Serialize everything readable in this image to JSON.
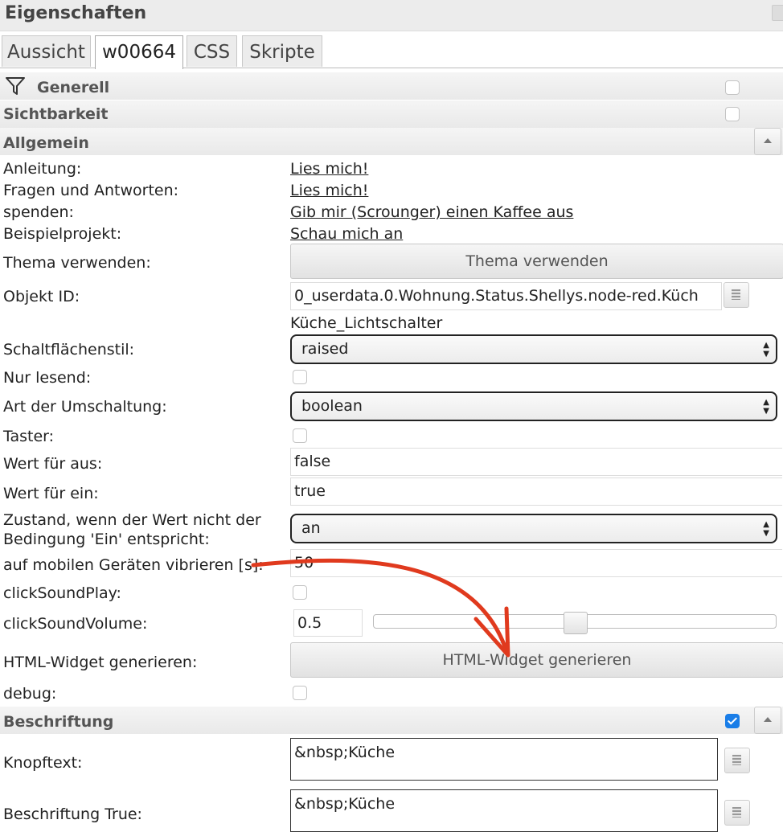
{
  "panel": {
    "title": "Eigenschaften"
  },
  "tabs": [
    {
      "label": "Aussicht"
    },
    {
      "label": "w00664"
    },
    {
      "label": "CSS"
    },
    {
      "label": "Skripte"
    }
  ],
  "sections": {
    "generell": "Generell",
    "sichtbarkeit": "Sichtbarkeit",
    "allgemein": "Allgemein",
    "beschriftung": "Beschriftung"
  },
  "links": {
    "anleitung_label": "Anleitung:",
    "anleitung": "Lies mich!",
    "faq_label": "Fragen und Antworten:",
    "faq": "Lies mich!",
    "spenden_label": "spenden:",
    "spenden": "Gib mir (Scrounger) einen Kaffee aus",
    "beispiel_label": "Beispielprojekt:",
    "beispiel": "Schau mich an"
  },
  "fields": {
    "thema_label": "Thema verwenden:",
    "thema_button": "Thema verwenden",
    "objekt_label": "Objekt ID:",
    "objekt_value": "0_userdata.0.Wohnung.Status.Shellys.node-red.Küch",
    "objekt_name": "Küche_Lichtschalter",
    "stil_label": "Schaltflächenstil:",
    "stil_value": "raised",
    "nurlesend_label": "Nur lesend:",
    "art_label": "Art der Umschaltung:",
    "art_value": "boolean",
    "taster_label": "Taster:",
    "aus_label": "Wert für aus:",
    "aus_value": "false",
    "ein_label": "Wert für ein:",
    "ein_value": "true",
    "zustand_label_1": "Zustand, wenn der Wert nicht der",
    "zustand_label_2": "Bedingung 'Ein' entspricht:",
    "zustand_value": "an",
    "vibrieren_label": "auf mobilen Geräten vibrieren [s]:",
    "vibrieren_value": "50",
    "sound_play_label": "clickSoundPlay:",
    "sound_volume_label": "clickSoundVolume:",
    "sound_volume_value": "0.5",
    "html_label": "HTML-Widget generieren:",
    "html_button": "HTML-Widget generieren",
    "debug_label": "debug:",
    "knopf_label": "Knopftext:",
    "knopf_value": "&nbsp;Küche",
    "true_label": "Beschriftung True:",
    "true_value": "&nbsp;Küche"
  },
  "slider": {
    "value": 0.5
  },
  "colors": {
    "annotation_arrow": "#e03a1e",
    "checkbox_checked": "#1a7ee8"
  }
}
